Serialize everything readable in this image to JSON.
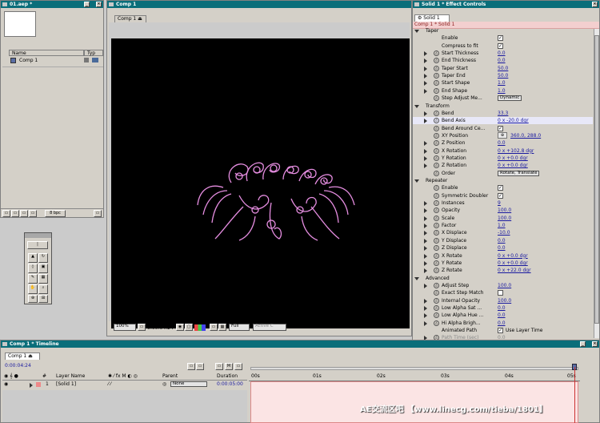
{
  "project": {
    "title": "01.aep *",
    "columns": {
      "name": "Name",
      "type": "Typ"
    },
    "items": [
      {
        "name": "Comp 1"
      }
    ],
    "bpc": "8 bpc"
  },
  "comp_viewer": {
    "title": "Comp 1",
    "tab": "Comp 1",
    "zoom": "100%",
    "timecode": "0:00:04:24",
    "resolution": "Full",
    "active_camera": "Active C"
  },
  "effect_controls": {
    "title": "Solid 1 * Effect Controls",
    "tab": "Solid 1",
    "layer_path": "Comp 1 * Solid 1",
    "rows": [
      {
        "indent": 0,
        "tw": "o",
        "label": "Taper",
        "kind": "group"
      },
      {
        "indent": 1,
        "tw": "",
        "label": "Enable",
        "kind": "check",
        "value": "✓"
      },
      {
        "indent": 1,
        "tw": "",
        "label": "Compress to fit",
        "kind": "check",
        "value": "✓"
      },
      {
        "indent": 1,
        "tw": "c",
        "sw": true,
        "label": "Start Thickness",
        "kind": "val",
        "value": "0.0"
      },
      {
        "indent": 1,
        "tw": "c",
        "sw": true,
        "label": "End Thickness",
        "kind": "val",
        "value": "0.0"
      },
      {
        "indent": 1,
        "tw": "c",
        "sw": true,
        "label": "Taper Start",
        "kind": "val",
        "value": "50.0"
      },
      {
        "indent": 1,
        "tw": "c",
        "sw": true,
        "label": "Taper End",
        "kind": "val",
        "value": "50.0"
      },
      {
        "indent": 1,
        "tw": "c",
        "sw": true,
        "label": "Start Shape",
        "kind": "val",
        "value": "1.0"
      },
      {
        "indent": 1,
        "tw": "c",
        "sw": true,
        "label": "End Shape",
        "kind": "val",
        "value": "1.0"
      },
      {
        "indent": 1,
        "tw": "",
        "sw": true,
        "label": "Step Adjust Me...",
        "kind": "dd",
        "value": "Dynamic"
      },
      {
        "indent": 0,
        "tw": "o",
        "label": "Transform",
        "kind": "group"
      },
      {
        "indent": 1,
        "tw": "c",
        "sw": true,
        "label": "Bend",
        "kind": "val",
        "value": "33.3"
      },
      {
        "indent": 1,
        "tw": "c",
        "sw": true,
        "label": "Bend Axis",
        "kind": "angle",
        "value": "0 x -20.0 dgr",
        "hl": true
      },
      {
        "indent": 1,
        "tw": "",
        "sw": true,
        "label": "Bend Around Ce...",
        "kind": "check",
        "value": "✓"
      },
      {
        "indent": 1,
        "tw": "",
        "sw": true,
        "label": "XY Position",
        "kind": "pos",
        "value": "360.0, 288.0"
      },
      {
        "indent": 1,
        "tw": "c",
        "sw": true,
        "label": "Z Position",
        "kind": "val",
        "value": "0.0"
      },
      {
        "indent": 1,
        "tw": "c",
        "sw": true,
        "label": "X Rotation",
        "kind": "angle",
        "value": "0 x +102.8 dgr"
      },
      {
        "indent": 1,
        "tw": "c",
        "sw": true,
        "label": "Y Rotation",
        "kind": "angle",
        "value": "0 x +0.0 dgr"
      },
      {
        "indent": 1,
        "tw": "c",
        "sw": true,
        "label": "Z Rotation",
        "kind": "angle",
        "value": "0 x +0.0 dgr"
      },
      {
        "indent": 1,
        "tw": "",
        "sw": true,
        "label": "Order",
        "kind": "dd",
        "value": "Rotate, Translate"
      },
      {
        "indent": 0,
        "tw": "o",
        "label": "Repeater",
        "kind": "group"
      },
      {
        "indent": 1,
        "tw": "",
        "sw": true,
        "label": "Enable",
        "kind": "check",
        "value": "✓"
      },
      {
        "indent": 1,
        "tw": "",
        "sw": true,
        "label": "Symmetric Doubler",
        "kind": "check",
        "value": "✓"
      },
      {
        "indent": 1,
        "tw": "c",
        "sw": true,
        "label": "Instances",
        "kind": "val",
        "value": "9"
      },
      {
        "indent": 1,
        "tw": "c",
        "sw": true,
        "label": "Opacity",
        "kind": "val",
        "value": "100.0"
      },
      {
        "indent": 1,
        "tw": "c",
        "sw": true,
        "label": "Scale",
        "kind": "val",
        "value": "100.0"
      },
      {
        "indent": 1,
        "tw": "c",
        "sw": true,
        "label": "Factor",
        "kind": "val",
        "value": "1.0"
      },
      {
        "indent": 1,
        "tw": "c",
        "sw": true,
        "label": "X Displace",
        "kind": "val",
        "value": "-10.0"
      },
      {
        "indent": 1,
        "tw": "c",
        "sw": true,
        "label": "Y Displace",
        "kind": "val",
        "value": "0.0"
      },
      {
        "indent": 1,
        "tw": "c",
        "sw": true,
        "label": "Z Displace",
        "kind": "val",
        "value": "0.0"
      },
      {
        "indent": 1,
        "tw": "c",
        "sw": true,
        "label": "X Rotate",
        "kind": "angle",
        "value": "0 x +0.0 dgr"
      },
      {
        "indent": 1,
        "tw": "c",
        "sw": true,
        "label": "Y Rotate",
        "kind": "angle",
        "value": "0 x +0.0 dgr"
      },
      {
        "indent": 1,
        "tw": "c",
        "sw": true,
        "label": "Z Rotate",
        "kind": "angle",
        "value": "0 x +22.0 dgr"
      },
      {
        "indent": 0,
        "tw": "o",
        "label": "Advanced",
        "kind": "group"
      },
      {
        "indent": 1,
        "tw": "c",
        "sw": true,
        "label": "Adjust Step",
        "kind": "val",
        "value": "100.0"
      },
      {
        "indent": 1,
        "tw": "",
        "sw": true,
        "label": "Exact Step Match",
        "kind": "check",
        "value": ""
      },
      {
        "indent": 1,
        "tw": "c",
        "sw": true,
        "label": "Internal Opacity",
        "kind": "val",
        "value": "100.0"
      },
      {
        "indent": 1,
        "tw": "c",
        "sw": true,
        "label": "Low Alpha Sat ...",
        "kind": "val",
        "value": "0.0"
      },
      {
        "indent": 1,
        "tw": "c",
        "sw": true,
        "label": "Low Alpha Hue ...",
        "kind": "val",
        "value": "0.0"
      },
      {
        "indent": 1,
        "tw": "c",
        "sw": true,
        "label": "Hi Alpha Brigh...",
        "kind": "val",
        "value": "0.0"
      },
      {
        "indent": 1,
        "tw": "",
        "sw": false,
        "label": "Animated Path",
        "kind": "check",
        "value": "✓",
        "extra": "Use Layer Time"
      },
      {
        "indent": 1,
        "tw": "c",
        "sw": true,
        "label": "Path Time (sec)",
        "kind": "val",
        "value": "0.0",
        "dim": true
      }
    ]
  },
  "timeline": {
    "title": "Comp 1 * Timeline",
    "tab": "Comp 1",
    "timecode": "0:00:04:24",
    "columns": {
      "layer_name": "Layer Name",
      "parent": "Parent",
      "duration": "Duration"
    },
    "layers": [
      {
        "num": "1",
        "name": "[Solid 1]",
        "parent": "None",
        "duration": "0:00:05:00"
      }
    ],
    "ruler": [
      "00s",
      "01s",
      "02s",
      "03s",
      "04s",
      "05s"
    ]
  },
  "watermark": "AE交流区吧 【www.linecg.com/tieba/1801】",
  "colors": {
    "title_bar": "#0a6e7a",
    "path": "#e58de0",
    "highlight_row": "#e8e8f8",
    "layer_bar": "#f1b9b9"
  }
}
